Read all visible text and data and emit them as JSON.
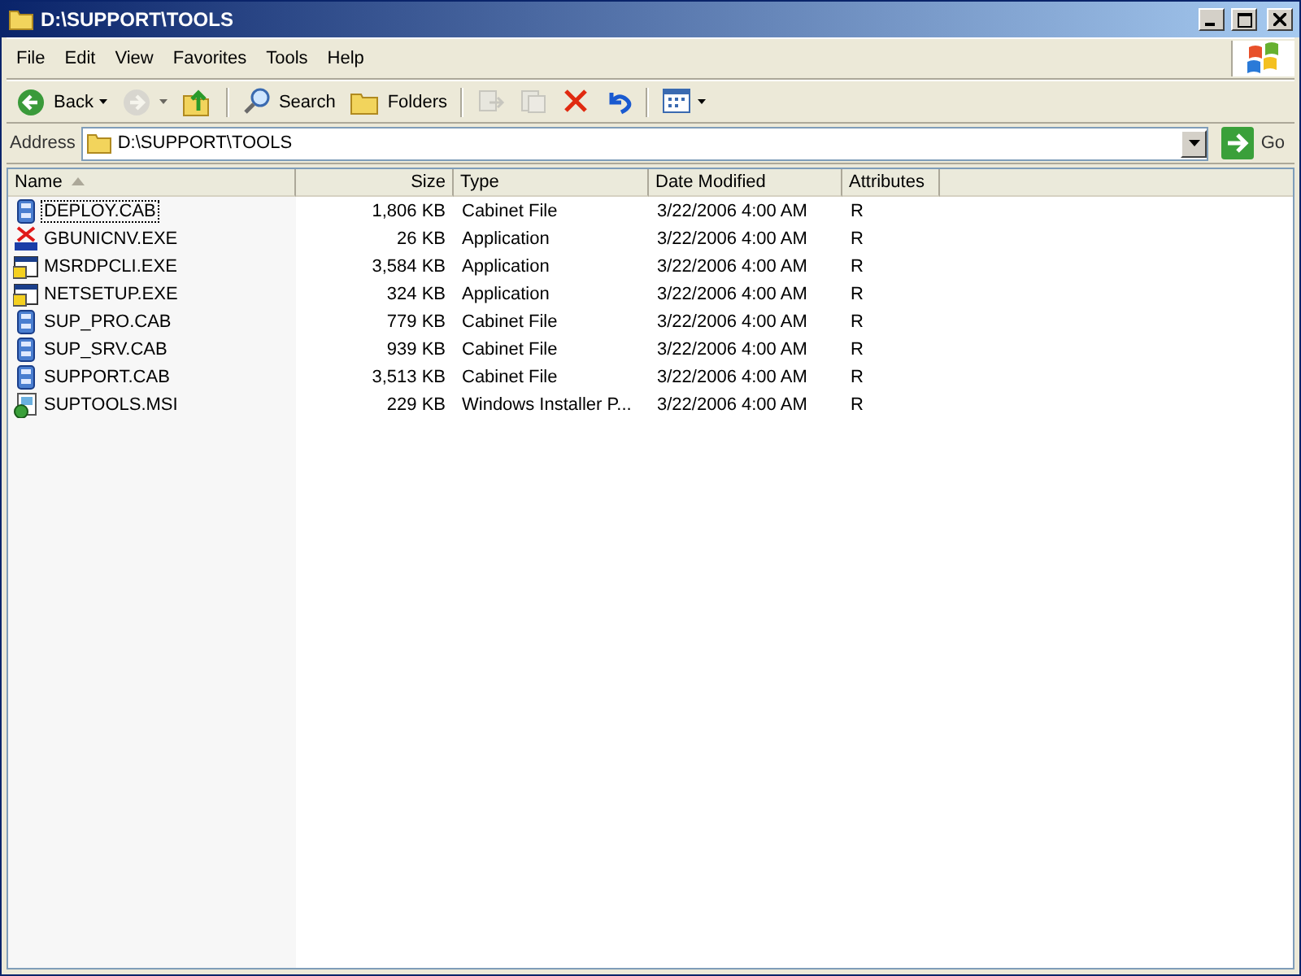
{
  "window": {
    "title": "D:\\SUPPORT\\TOOLS"
  },
  "menu": [
    "File",
    "Edit",
    "View",
    "Favorites",
    "Tools",
    "Help"
  ],
  "toolbar": [
    {
      "kind": "back",
      "label": "Back",
      "disabled": false
    },
    {
      "kind": "forward",
      "disabled": true
    },
    {
      "kind": "up",
      "disabled": false
    },
    {
      "kind": "sep"
    },
    {
      "kind": "search",
      "label": "Search",
      "disabled": false
    },
    {
      "kind": "folders",
      "label": "Folders",
      "disabled": false
    },
    {
      "kind": "sep"
    },
    {
      "kind": "moveto",
      "disabled": true
    },
    {
      "kind": "copyto",
      "disabled": true
    },
    {
      "kind": "delete",
      "disabled": false
    },
    {
      "kind": "undo",
      "disabled": false
    },
    {
      "kind": "sep"
    },
    {
      "kind": "views",
      "disabled": false
    }
  ],
  "address": {
    "label": "Address",
    "value": "D:\\SUPPORT\\TOOLS",
    "go": "Go"
  },
  "columns": [
    {
      "label": "Name",
      "sorted": true
    },
    {
      "label": "Size",
      "sorted": false
    },
    {
      "label": "Type",
      "sorted": false
    },
    {
      "label": "Date Modified",
      "sorted": false
    },
    {
      "label": "Attributes",
      "sorted": false
    }
  ],
  "files": [
    {
      "kind": "cabinet",
      "name": "DEPLOY.CAB",
      "size": "1,806 KB",
      "type": "Cabinet File",
      "date": "3/22/2006 4:00 AM",
      "attributes": "R",
      "focused": true
    },
    {
      "kind": "gbapp",
      "name": "GBUNICNV.EXE",
      "size": "26 KB",
      "type": "Application",
      "date": "3/22/2006 4:00 AM",
      "attributes": "R",
      "focused": false
    },
    {
      "kind": "app",
      "name": "MSRDPCLI.EXE",
      "size": "3,584 KB",
      "type": "Application",
      "date": "3/22/2006 4:00 AM",
      "attributes": "R",
      "focused": false
    },
    {
      "kind": "app",
      "name": "NETSETUP.EXE",
      "size": "324 KB",
      "type": "Application",
      "date": "3/22/2006 4:00 AM",
      "attributes": "R",
      "focused": false
    },
    {
      "kind": "cabinet",
      "name": "SUP_PRO.CAB",
      "size": "779 KB",
      "type": "Cabinet File",
      "date": "3/22/2006 4:00 AM",
      "attributes": "R",
      "focused": false
    },
    {
      "kind": "cabinet",
      "name": "SUP_SRV.CAB",
      "size": "939 KB",
      "type": "Cabinet File",
      "date": "3/22/2006 4:00 AM",
      "attributes": "R",
      "focused": false
    },
    {
      "kind": "cabinet",
      "name": "SUPPORT.CAB",
      "size": "3,513 KB",
      "type": "Cabinet File",
      "date": "3/22/2006 4:00 AM",
      "attributes": "R",
      "focused": false
    },
    {
      "kind": "msi",
      "name": "SUPTOOLS.MSI",
      "size": "229 KB",
      "type": "Windows Installer P...",
      "date": "3/22/2006 4:00 AM",
      "attributes": "R",
      "focused": false
    }
  ]
}
